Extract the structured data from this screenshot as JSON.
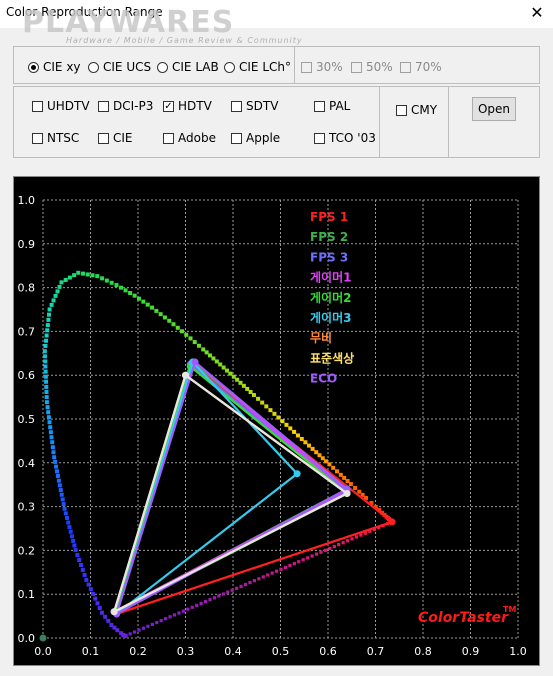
{
  "window": {
    "title": "Color Reproduction Range",
    "close_icon": "close-icon",
    "watermark": "PLAYWARES",
    "watermark_sub": "Hardware / Mobile / Game Review & Community"
  },
  "color_space": {
    "options": [
      {
        "label": "CIE xy",
        "checked": true
      },
      {
        "label": "CIE UCS",
        "checked": false
      },
      {
        "label": "CIE LAB",
        "checked": false
      },
      {
        "label": "CIE LCh°",
        "checked": false
      }
    ],
    "percent_options": [
      {
        "label": "30%",
        "checked": false,
        "enabled": false
      },
      {
        "label": "50%",
        "checked": false,
        "enabled": false
      },
      {
        "label": "70%",
        "checked": false,
        "enabled": false
      }
    ]
  },
  "standards": {
    "row1": [
      {
        "label": "UHDTV",
        "checked": false
      },
      {
        "label": "DCI-P3",
        "checked": false
      },
      {
        "label": "HDTV",
        "checked": true
      },
      {
        "label": "SDTV",
        "checked": false
      },
      {
        "label": "PAL",
        "checked": false
      }
    ],
    "row2": [
      {
        "label": "NTSC",
        "checked": false
      },
      {
        "label": "CIE",
        "checked": false
      },
      {
        "label": "Adobe",
        "checked": false
      },
      {
        "label": "Apple",
        "checked": false
      },
      {
        "label": "TCO '03",
        "checked": false
      }
    ],
    "cmy": {
      "label": "CMY",
      "checked": false
    },
    "open_label": "Open"
  },
  "chart_data": {
    "type": "scatter",
    "title": "",
    "xlabel": "",
    "ylabel": "",
    "xlim": [
      0,
      1
    ],
    "ylim": [
      0,
      1
    ],
    "grid": true,
    "x_ticks": [
      "0.0",
      "0.1",
      "0.2",
      "0.3",
      "0.4",
      "0.5",
      "0.6",
      "0.7",
      "0.8",
      "0.9",
      "1.0"
    ],
    "y_ticks": [
      "0.0",
      "0.1",
      "0.2",
      "0.3",
      "0.4",
      "0.5",
      "0.6",
      "0.7",
      "0.8",
      "0.9",
      "1.0"
    ],
    "legend_position": "top-right",
    "brand_label": "ColorTaster",
    "brand_tm": "TM",
    "brand_color": "#ff1a1a",
    "series": [
      {
        "name": "FPS 1",
        "color": "#ff2020",
        "points": [
          [
            0.735,
            0.265
          ],
          [
            0.155,
            0.055
          ],
          [
            0.315,
            0.625
          ]
        ]
      },
      {
        "name": "FPS 2",
        "color": "#3cb44b",
        "points": [
          [
            0.64,
            0.34
          ],
          [
            0.15,
            0.06
          ],
          [
            0.315,
            0.63
          ]
        ]
      },
      {
        "name": "FPS 3",
        "color": "#6f6fff",
        "points": [
          [
            0.64,
            0.335
          ],
          [
            0.15,
            0.06
          ],
          [
            0.31,
            0.625
          ]
        ]
      },
      {
        "name": "게이머1",
        "color": "#e040fb",
        "points": [
          [
            0.635,
            0.335
          ],
          [
            0.15,
            0.06
          ],
          [
            0.32,
            0.63
          ]
        ]
      },
      {
        "name": "게이머2",
        "color": "#33dd33",
        "points": [
          [
            0.64,
            0.33
          ],
          [
            0.155,
            0.06
          ],
          [
            0.31,
            0.62
          ]
        ]
      },
      {
        "name": "게이머3",
        "color": "#33ccee",
        "points": [
          [
            0.535,
            0.375
          ],
          [
            0.155,
            0.055
          ],
          [
            0.315,
            0.63
          ]
        ]
      },
      {
        "name": "무비",
        "color": "#ff8a3d",
        "points": [
          [
            0.64,
            0.33
          ],
          [
            0.15,
            0.06
          ],
          [
            0.3,
            0.6
          ]
        ]
      },
      {
        "name": "표준색상",
        "color": "#ffe066",
        "points": [
          [
            0.64,
            0.33
          ],
          [
            0.15,
            0.06
          ],
          [
            0.3,
            0.6
          ]
        ]
      },
      {
        "name": "ECO",
        "color": "#a05cff",
        "points": [
          [
            0.64,
            0.34
          ],
          [
            0.155,
            0.055
          ],
          [
            0.32,
            0.63
          ]
        ]
      },
      {
        "name": "",
        "color": "#e6e6e6",
        "points": [
          [
            0.64,
            0.33
          ],
          [
            0.15,
            0.06
          ],
          [
            0.3,
            0.6
          ]
        ]
      }
    ],
    "locus_points": [
      [
        0.1741,
        0.005
      ],
      [
        0.1738,
        0.0049
      ],
      [
        0.1733,
        0.0048
      ],
      [
        0.1726,
        0.0048
      ],
      [
        0.1714,
        0.0051
      ],
      [
        0.1689,
        0.0069
      ],
      [
        0.1644,
        0.0109
      ],
      [
        0.1566,
        0.0177
      ],
      [
        0.144,
        0.0297
      ],
      [
        0.1241,
        0.0578
      ],
      [
        0.0913,
        0.1327
      ],
      [
        0.0687,
        0.2007
      ],
      [
        0.0454,
        0.295
      ],
      [
        0.0235,
        0.4127
      ],
      [
        0.0082,
        0.5384
      ],
      [
        0.0039,
        0.6548
      ],
      [
        0.0139,
        0.7502
      ],
      [
        0.0389,
        0.812
      ],
      [
        0.0743,
        0.8338
      ],
      [
        0.1142,
        0.8262
      ],
      [
        0.1547,
        0.8059
      ],
      [
        0.1929,
        0.7816
      ],
      [
        0.2296,
        0.7543
      ],
      [
        0.2658,
        0.7243
      ],
      [
        0.3016,
        0.6923
      ],
      [
        0.3373,
        0.6589
      ],
      [
        0.3731,
        0.6245
      ],
      [
        0.4087,
        0.5896
      ],
      [
        0.4441,
        0.5547
      ],
      [
        0.4788,
        0.5202
      ],
      [
        0.5125,
        0.4866
      ],
      [
        0.5448,
        0.4544
      ],
      [
        0.5752,
        0.4242
      ],
      [
        0.6029,
        0.3965
      ],
      [
        0.627,
        0.3725
      ],
      [
        0.6482,
        0.3514
      ],
      [
        0.6658,
        0.334
      ],
      [
        0.6801,
        0.3197
      ],
      [
        0.6915,
        0.3083
      ],
      [
        0.7006,
        0.2993
      ],
      [
        0.7079,
        0.292
      ],
      [
        0.714,
        0.2859
      ],
      [
        0.719,
        0.2809
      ],
      [
        0.723,
        0.277
      ],
      [
        0.726,
        0.274
      ],
      [
        0.7283,
        0.2717
      ],
      [
        0.73,
        0.27
      ],
      [
        0.7347,
        0.2653
      ]
    ],
    "white_point": [
      0.0,
      0.0
    ]
  }
}
